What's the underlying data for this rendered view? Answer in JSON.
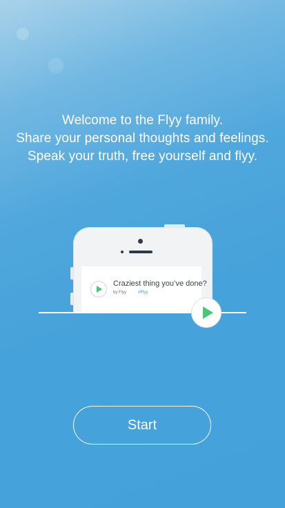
{
  "intro": {
    "line1": "Welcome to the Flyy family.",
    "line2": "Share your personal thoughts and feelings.",
    "line3": "Speak your truth, free yourself and flyy."
  },
  "preview_card": {
    "title": "Craziest thing you’ve done?",
    "author": "by Flyy",
    "tag": "#Flyy"
  },
  "start_button": {
    "label": "Start"
  },
  "colors": {
    "background": "#45a1d9",
    "accent_green": "#4cc47a",
    "text": "#ffffff"
  },
  "icons": {
    "play": "play-icon"
  }
}
